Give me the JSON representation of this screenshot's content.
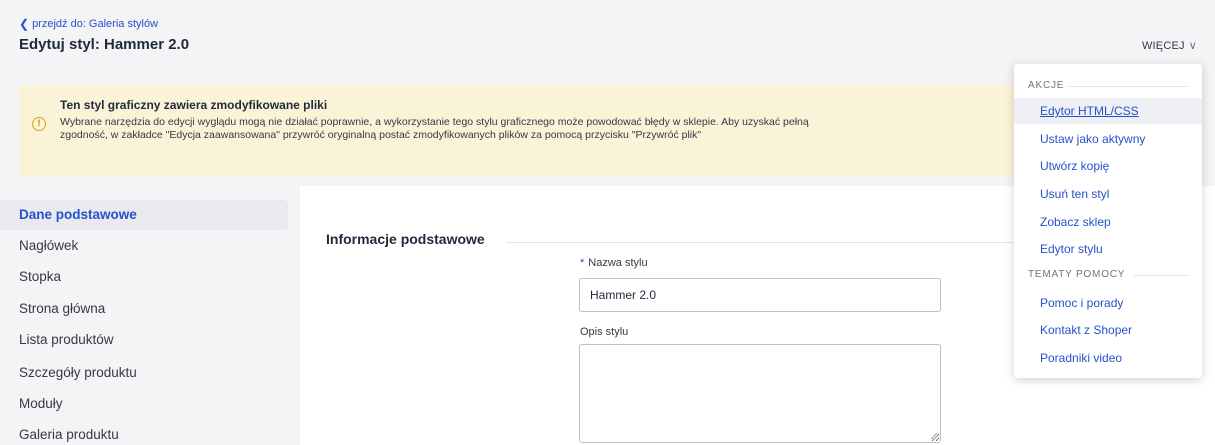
{
  "header": {
    "back_link": "przejdź do: Galeria stylów",
    "title": "Edytuj styl: Hammer 2.0",
    "more_button": "WIĘCEJ"
  },
  "alert": {
    "title": "Ten styl graficzny zawiera zmodyfikowane pliki",
    "body": "Wybrane narzędzia do edycji wyglądu mogą nie działać poprawnie, a wykorzystanie tego stylu graficznego może powodować błędy w sklepie. Aby uzyskać pełną zgodność, w zakładce \"Edycja zaawansowana\" przywróć oryginalną postać zmodyfikowanych plików za pomocą przycisku \"Przywróć plik\"",
    "icon": "warning-circle-icon",
    "color": "#fbf3d8"
  },
  "sidebar": {
    "items": [
      {
        "label": "Dane podstawowe",
        "active": true
      },
      {
        "label": "Nagłówek"
      },
      {
        "label": "Stopka"
      },
      {
        "label": "Strona główna"
      },
      {
        "label": "Lista produktów"
      },
      {
        "label": "Szczegóły produktu"
      },
      {
        "label": "Moduły"
      },
      {
        "label": "Galeria produktu"
      }
    ]
  },
  "main": {
    "section_title": "Informacje podstawowe",
    "name_field": {
      "required_mark": "*",
      "label": "Nazwa stylu",
      "value": "Hammer 2.0"
    },
    "description_field": {
      "label": "Opis stylu",
      "value": ""
    }
  },
  "dropdown": {
    "actions_header": "AKCJE",
    "actions": [
      "Edytor HTML/CSS",
      "Ustaw jako aktywny",
      "Utwórz kopię",
      "Usuń ten styl",
      "Zobacz sklep",
      "Edytor stylu"
    ],
    "help_header": "TEMATY POMOCY",
    "help": [
      "Pomoc i porady",
      "Kontakt z Shoper",
      "Poradniki video"
    ]
  },
  "colors": {
    "accent": "#2751c9",
    "warning": "#d8a315"
  }
}
